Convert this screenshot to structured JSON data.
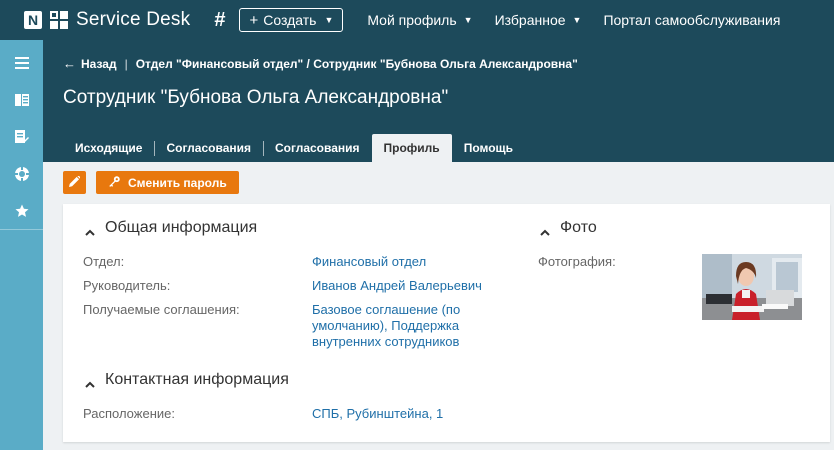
{
  "topbar": {
    "logo_letter": "N",
    "app_title": "Service Desk",
    "hash_symbol": "#",
    "create_plus": "+",
    "create_label": "Создать",
    "nav": [
      {
        "label": "Мой профиль",
        "has_dropdown": true
      },
      {
        "label": "Избранное",
        "has_dropdown": true
      },
      {
        "label": "Портал самообслуживания",
        "has_dropdown": false
      }
    ],
    "caret": "▼"
  },
  "sidebar": {
    "items": [
      "menu-icon",
      "book-icon",
      "edit-list-icon",
      "lifebuoy-icon",
      "star-icon"
    ]
  },
  "header": {
    "back_arrow": "←",
    "back_label": "Назад",
    "crumb_sep": "|",
    "breadcrumb_path": "Отдел \"Финансовый отдел\" / Сотрудник \"Бубнова Ольга Александровна\"",
    "title": "Сотрудник \"Бубнова Ольга Александровна\"",
    "tabs": [
      {
        "label": "Исходящие"
      },
      {
        "label": "Согласования"
      },
      {
        "label": "Согласования"
      },
      {
        "label": "Профиль",
        "active": true
      },
      {
        "label": "Помощь"
      }
    ]
  },
  "actions": {
    "edit_icon": "pencil-icon",
    "change_password_label": "Сменить пароль",
    "change_password_icon": "key-icon"
  },
  "general": {
    "title": "Общая информация",
    "fields": [
      {
        "label": "Отдел:",
        "value": "Финансовый отдел"
      },
      {
        "label": "Руководитель:",
        "value": "Иванов Андрей Валерьевич"
      },
      {
        "label": "Получаемые соглашения:",
        "value_lines": [
          "Базовое соглашение (по",
          "умолчанию), Поддержка",
          "внутренних сотрудников"
        ]
      }
    ]
  },
  "contact": {
    "title": "Контактная информация",
    "fields": [
      {
        "label": "Расположение:",
        "value": "СПБ, Рубинштейна, 1"
      }
    ]
  },
  "photo": {
    "title": "Фото",
    "label": "Фотография:"
  },
  "colors": {
    "header_bg": "#1d4a5b",
    "sidebar_bg": "#5aacc7",
    "accent_orange": "#e8780e",
    "link_blue": "#1f6fa8",
    "content_bg": "#eef1f3"
  }
}
